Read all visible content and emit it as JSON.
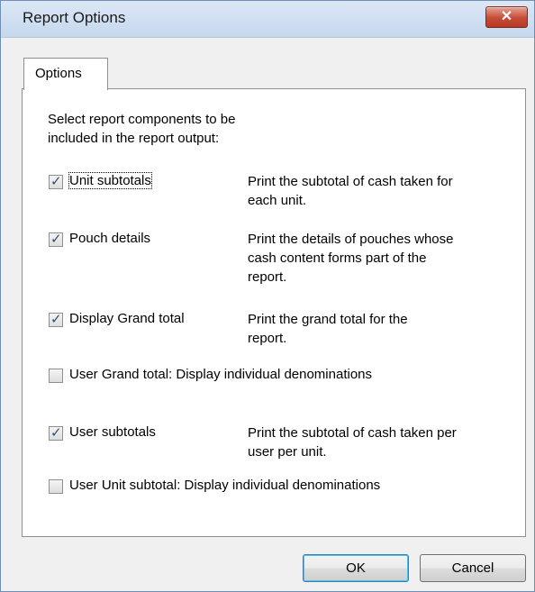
{
  "window": {
    "title": "Report Options",
    "close_label": "✕"
  },
  "tabs": [
    {
      "label": "Options"
    }
  ],
  "intro": [
    "Select report components to be",
    "included in the report output:"
  ],
  "options": [
    {
      "label": "Unit subtotals",
      "checked": true,
      "description": [
        "Print the subtotal of cash taken for",
        "each unit."
      ]
    },
    {
      "label": "Pouch details",
      "checked": true,
      "description": [
        "Print the details of pouches whose",
        "cash content forms part of the",
        "report."
      ]
    },
    {
      "label": "Display Grand total",
      "checked": true,
      "description": [
        "Print the grand total for the",
        "report."
      ]
    },
    {
      "label": "User Grand total: Display individual denominations",
      "checked": false,
      "description": []
    },
    {
      "label": "User subtotals",
      "checked": true,
      "description": [
        "Print the subtotal of cash taken per",
        "user per unit."
      ]
    },
    {
      "label": "User Unit subtotal: Display individual denominations",
      "checked": false,
      "description": []
    }
  ],
  "buttons": {
    "ok_label": "OK",
    "cancel_label": "Cancel"
  }
}
